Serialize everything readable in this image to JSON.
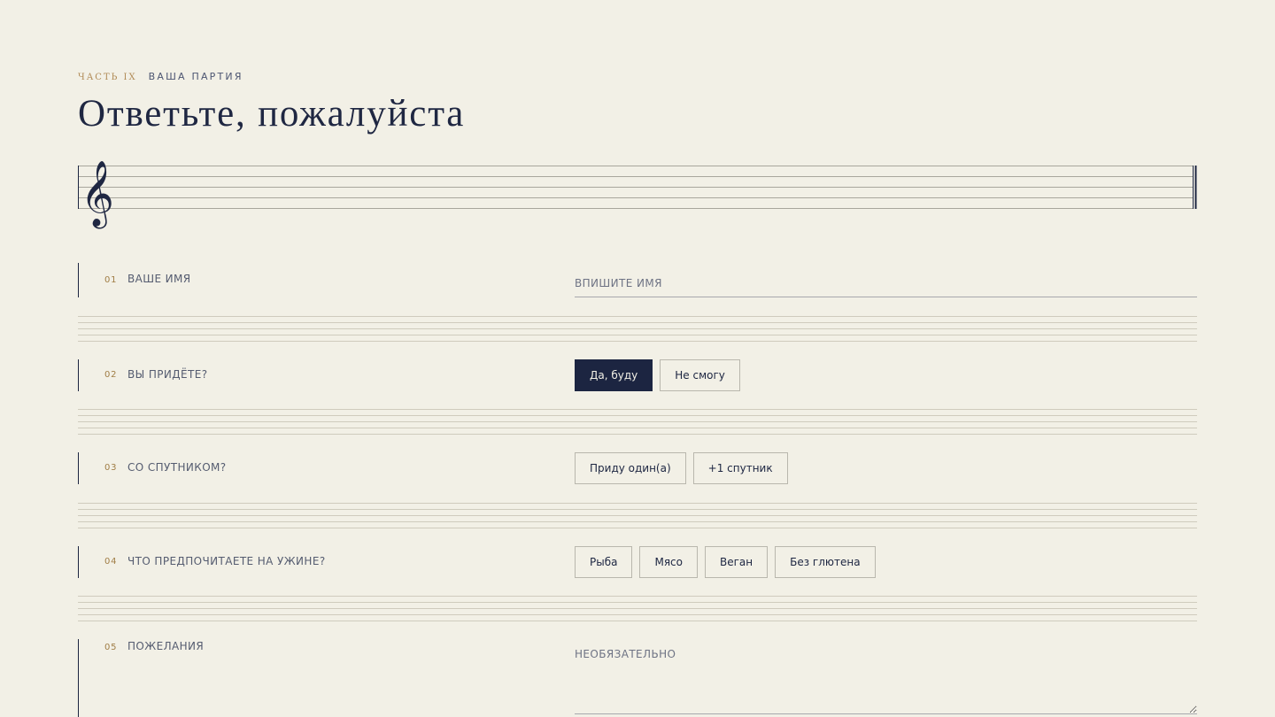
{
  "header": {
    "part": "ЧАСТЬ IX",
    "section": "ВАША ПАРТИЯ",
    "title": "Ответьте, пожалуйста"
  },
  "questions": [
    {
      "number": "01",
      "label": "ВАШЕ ИМЯ",
      "type": "text",
      "placeholder": "ВПИШИТЕ ИМЯ"
    },
    {
      "number": "02",
      "label": "ВЫ ПРИДЁТЕ?",
      "type": "choice",
      "options": [
        "Да, буду",
        "Не смогу"
      ],
      "selected": "Да, буду"
    },
    {
      "number": "03",
      "label": "СО СПУТНИКОМ?",
      "type": "choice",
      "options": [
        "Приду один(а)",
        "+1 спутник"
      ],
      "selected": null
    },
    {
      "number": "04",
      "label": "ЧТО ПРЕДПОЧИТАЕТЕ НА УЖИНЕ?",
      "type": "choice",
      "options": [
        "Рыба",
        "Мясо",
        "Веган",
        "Без глютена"
      ],
      "selected": null
    },
    {
      "number": "05",
      "label": "ПОЖЕЛАНИЯ",
      "type": "textarea",
      "placeholder": "НЕОБЯЗАТЕЛЬНО"
    }
  ],
  "icons": {
    "staff": "treble-clef-icon"
  },
  "colors": {
    "background": "#f2f0e6",
    "ink": "#1c2541",
    "accent": "#b08a55",
    "muted": "#555c70",
    "staff_line": "#a8a69c"
  }
}
